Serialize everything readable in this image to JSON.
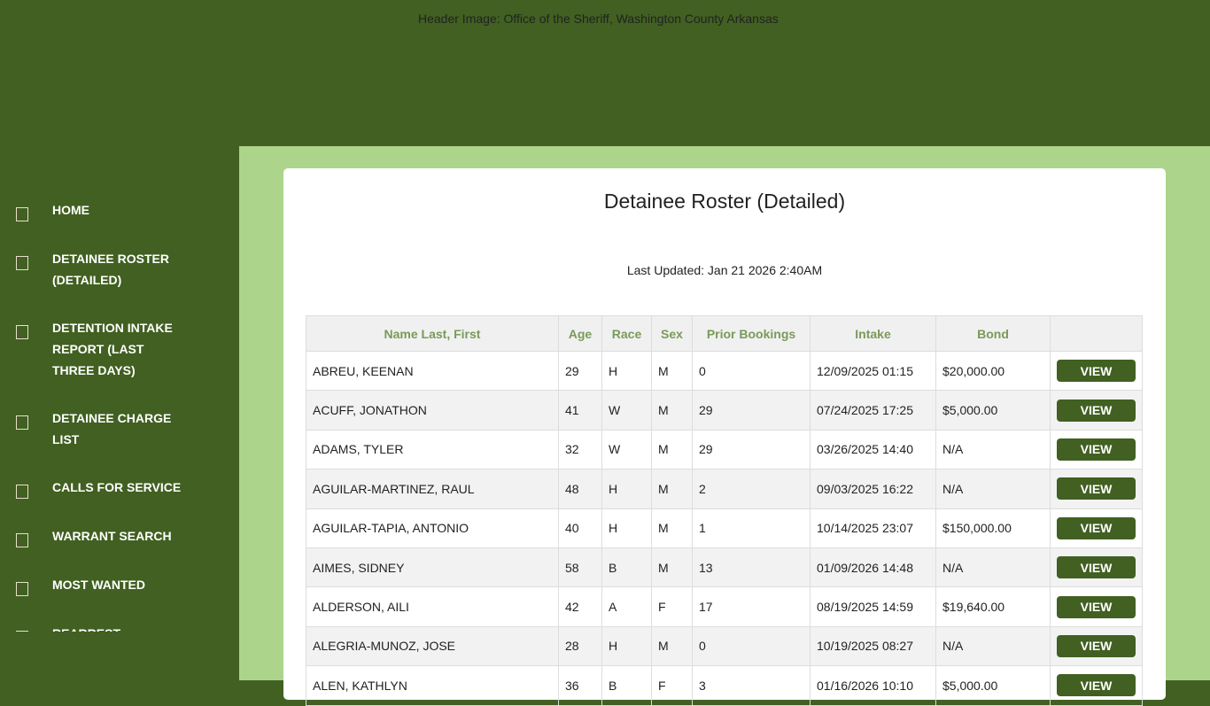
{
  "header": {
    "image_alt": "Header Image: Office of the Sheriff, Washington County Arkansas"
  },
  "nav": [
    "HOME",
    "DETAINEE ROSTER (DETAILED)",
    "DETENTION INTAKE REPORT (LAST THREE DAYS)",
    "DETAINEE CHARGE LIST",
    "CALLS FOR SERVICE",
    "WARRANT SEARCH",
    "MOST WANTED",
    "REARREST NOTIFICATIONS"
  ],
  "page": {
    "title": "Detainee Roster (Detailed)",
    "last_updated": "Last Updated: Jan 21 2026 2:40AM",
    "view_label": "VIEW"
  },
  "columns": [
    "Name Last, First",
    "Age",
    "Race",
    "Sex",
    "Prior Bookings",
    "Intake",
    "Bond",
    ""
  ],
  "rows": [
    [
      "ABREU, KEENAN",
      "29",
      "H",
      "M",
      "0",
      "12/09/2025 01:15",
      "$20,000.00"
    ],
    [
      "ACUFF, JONATHON",
      "41",
      "W",
      "M",
      "29",
      "07/24/2025 17:25",
      "$5,000.00"
    ],
    [
      "ADAMS, TYLER",
      "32",
      "W",
      "M",
      "29",
      "03/26/2025 14:40",
      "N/A"
    ],
    [
      "AGUILAR-MARTINEZ, RAUL",
      "48",
      "H",
      "M",
      "2",
      "09/03/2025 16:22",
      "N/A"
    ],
    [
      "AGUILAR-TAPIA, ANTONIO",
      "40",
      "H",
      "M",
      "1",
      "10/14/2025 23:07",
      "$150,000.00"
    ],
    [
      "AIMES, SIDNEY",
      "58",
      "B",
      "M",
      "13",
      "01/09/2026 14:48",
      "N/A"
    ],
    [
      "ALDERSON, AILI",
      "42",
      "A",
      "F",
      "17",
      "08/19/2025 14:59",
      "$19,640.00"
    ],
    [
      "ALEGRIA-MUNOZ, JOSE",
      "28",
      "H",
      "M",
      "0",
      "10/19/2025 08:27",
      "N/A"
    ],
    [
      "ALEN, KATHLYN",
      "36",
      "B",
      "F",
      "3",
      "01/16/2026 10:10",
      "$5,000.00"
    ]
  ]
}
